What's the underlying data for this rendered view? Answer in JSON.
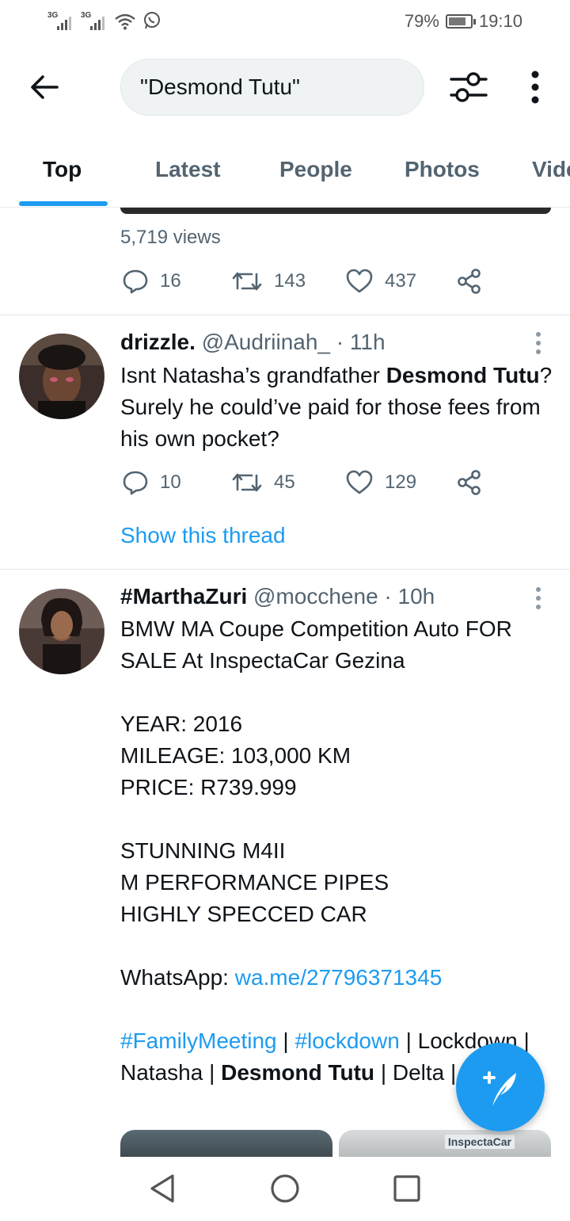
{
  "status_bar": {
    "signal_1": "3G",
    "signal_2": "3G",
    "battery_percent": "79%",
    "battery_level": 0.79,
    "time": "19:10"
  },
  "search": {
    "query": "\"Desmond Tutu\""
  },
  "tabs": [
    {
      "label": "Top",
      "active": true
    },
    {
      "label": "Latest",
      "active": false
    },
    {
      "label": "People",
      "active": false
    },
    {
      "label": "Photos",
      "active": false
    },
    {
      "label": "Videos",
      "active": false
    }
  ],
  "tweets": [
    {
      "views": "5,719 views",
      "replies": "16",
      "retweets": "143",
      "likes": "437"
    },
    {
      "name": "drizzle.",
      "handle": "@Audriinah_",
      "time": "· 11h",
      "text_part1": "Isnt Natasha’s grandfather ",
      "text_bold": "Desmond Tutu",
      "text_part2": "? Surely he could’ve paid for those fees from his own pocket?",
      "replies": "10",
      "retweets": "45",
      "likes": "129",
      "show_thread": "Show this thread"
    },
    {
      "name": "#MarthaZuri",
      "handle": "@mocchene",
      "time": "· 10h",
      "line1": "BMW MA Coupe Competition Auto FOR SALE At InspectaCar Gezina",
      "year": "YEAR: 2016",
      "mileage": "MILEAGE: 103,000 KM",
      "price": "PRICE: R739.999",
      "feat1": "STUNNING M4II",
      "feat2": "M PERFORMANCE PIPES",
      "feat3": "HIGHLY SPECCED CAR",
      "whatsapp_label": "WhatsApp: ",
      "whatsapp_link": "wa.me/27796371345",
      "tag1": "#FamilyMeeting",
      "sep1": " | ",
      "tag2": "#lockdown",
      "rest1": " | Lockdown | Natasha | ",
      "bold": "Desmond Tutu",
      "rest2": " | Delta | MacG",
      "media_label": "InspectaCar"
    }
  ],
  "colors": {
    "accent": "#1d9bf0",
    "text": "#0f1419",
    "muted": "#536471",
    "divider": "#e1e8ed"
  },
  "icons": [
    "back-arrow-icon",
    "filter-sliders-icon",
    "more-vertical-icon",
    "reply-icon",
    "retweet-icon",
    "like-icon",
    "share-icon",
    "compose-icon",
    "nav-back-icon",
    "nav-home-icon",
    "nav-recents-icon"
  ]
}
